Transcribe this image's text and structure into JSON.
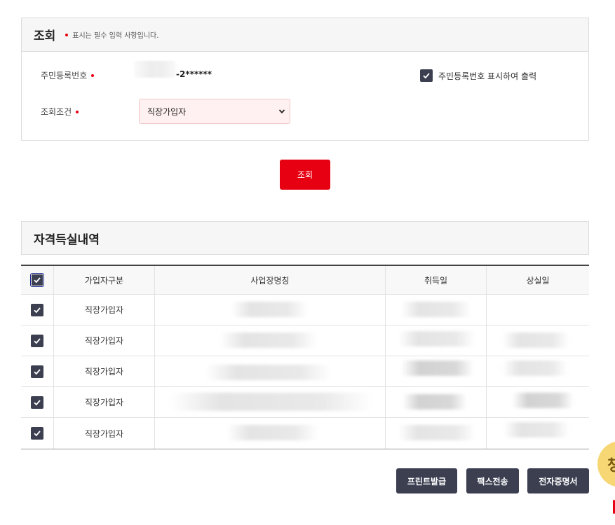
{
  "search_panel": {
    "title": "조회",
    "required_note": "표시는 필수 입력 사항입니다.",
    "ssn_label": "주민등록번호",
    "ssn_masked": "-2******",
    "print_option_label": "주민등록번호 표시하여 출력",
    "print_option_checked": true,
    "condition_label": "조회조건",
    "condition_selected": "직장가입자",
    "search_button": "조회"
  },
  "history": {
    "title": "자격득실내역",
    "columns": [
      "가입자구분",
      "사업장명칭",
      "취득일",
      "상실일"
    ],
    "rows": [
      {
        "type": "직장가입자",
        "checked": true
      },
      {
        "type": "직장가입자",
        "checked": true
      },
      {
        "type": "직장가입자",
        "checked": true
      },
      {
        "type": "직장가입자",
        "checked": true
      },
      {
        "type": "직장가입자",
        "checked": true
      }
    ]
  },
  "actions": {
    "print": "프린트발급",
    "fax": "팩스전송",
    "ecert": "전자증명서"
  },
  "floating_badge": "챙",
  "colors": {
    "accent": "#e60012",
    "dark_button": "#3b3f50",
    "select_bg": "#fff1f1"
  }
}
